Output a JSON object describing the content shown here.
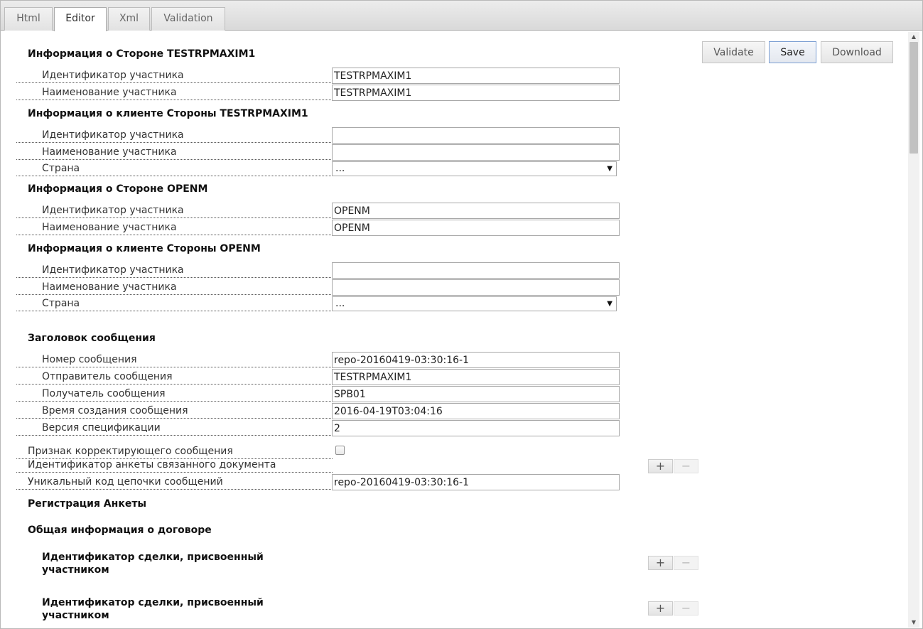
{
  "tabs": [
    "Html",
    "Editor",
    "Xml",
    "Validation"
  ],
  "active_tab": "Editor",
  "toolbar": {
    "validate": "Validate",
    "save": "Save",
    "download": "Download"
  },
  "party1": {
    "title": "Информация о Стороне TESTRPMAXIM1",
    "id_label": "Идентификатор участника",
    "id_value": "TESTRPMAXIM1",
    "name_label": "Наименование участника",
    "name_value": "TESTRPMAXIM1"
  },
  "client1": {
    "title": "Информация о клиенте Стороны TESTRPMAXIM1",
    "id_label": "Идентификатор участника",
    "id_value": "",
    "name_label": "Наименование участника",
    "name_value": "",
    "country_label": "Страна",
    "country_value": "..."
  },
  "party2": {
    "title": "Информация о Стороне OPENM",
    "id_label": "Идентификатор участника",
    "id_value": "OPENM",
    "name_label": "Наименование участника",
    "name_value": "OPENM"
  },
  "client2": {
    "title": "Информация о клиенте Стороны OPENM",
    "id_label": "Идентификатор участника",
    "id_value": "",
    "name_label": "Наименование участника",
    "name_value": "",
    "country_label": "Страна",
    "country_value": "..."
  },
  "header": {
    "title": "Заголовок сообщения",
    "msg_num_label": "Номер сообщения",
    "msg_num_value": "repo-20160419-03:30:16-1",
    "sender_label": "Отправитель сообщения",
    "sender_value": "TESTRPMAXIM1",
    "receiver_label": "Получатель сообщения",
    "receiver_value": "SPB01",
    "created_label": "Время создания сообщения",
    "created_value": "2016-04-19T03:04:16",
    "version_label": "Версия спецификации",
    "version_value": "2"
  },
  "misc": {
    "correcting_label": "Признак корректирующего сообщения",
    "linked_label": "Идентификатор анкеты связанного документа",
    "chain_label": "Уникальный код цепочки сообщений",
    "chain_value": "repo-20160419-03:30:16-1"
  },
  "registration_title": "Регистрация Анкеты",
  "contract_title": "Общая информация о договоре",
  "deal_id_title_1": "Идентификатор сделки, присвоенный участником",
  "deal_id_title_2": "Идентификатор сделки, присвоенный участником",
  "plus": "+",
  "minus": "−",
  "icons": {
    "select_arrow": "▼",
    "scroll_up": "▲",
    "scroll_down": "▼"
  }
}
